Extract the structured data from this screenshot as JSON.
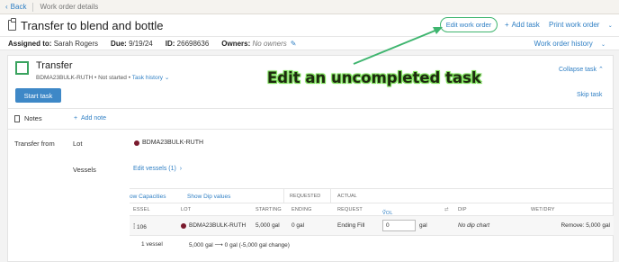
{
  "topbar": {
    "back_label": "Back",
    "breadcrumb": "Work order details"
  },
  "header": {
    "title": "Transfer to blend and bottle",
    "edit_work_order": "Edit work order",
    "add_task": "Add task",
    "print_work_order": "Print work order"
  },
  "meta": {
    "assigned_label": "Assigned to:",
    "assigned_value": "Sarah Rogers",
    "due_label": "Due:",
    "due_value": "9/19/24",
    "id_label": "ID:",
    "id_value": "26698636",
    "owners_label": "Owners:",
    "owners_value": "No owners",
    "history": "Work order history"
  },
  "task": {
    "title": "Transfer",
    "lot_code": "BDMA23BULK-RUTH",
    "status": "Not started",
    "history_link": "Task history",
    "collapse": "Collapse task",
    "start": "Start task",
    "skip": "Skip task"
  },
  "notes": {
    "label": "Notes",
    "add": "Add note"
  },
  "transfer": {
    "from_label": "Transfer from",
    "lot_label": "Lot",
    "lot_value": "BDMA23BULK-RUTH",
    "vessels_label": "Vessels",
    "edit_vessels": "Edit vessels (1)"
  },
  "vessel_table": {
    "show_capacities": "ow Capacities",
    "show_dip": "Show Dip values",
    "requested": "REQUESTED",
    "actual": "ACTUAL",
    "headers": [
      "ESSEL",
      "LOT",
      "STARTING",
      "ENDING",
      "REQUEST",
      "VOL",
      "DIP",
      "WET/DRY"
    ],
    "row": {
      "vessel": "106",
      "lot": "BDMA23BULK-RUTH",
      "starting": "5,000 gal",
      "ending": "0 gal",
      "request": "Ending Fill",
      "vol": "0",
      "vol_unit": "gal",
      "dip": "No dip chart",
      "remove": "Remove: 5,000 gal"
    },
    "footer": {
      "count": "1 vessel",
      "summary": "5,000 gal ⟶ 0 gal (-5,000 gal change)"
    }
  },
  "annotation": {
    "text": "Edit an uncompleted  task"
  },
  "colors": {
    "link": "#2f7fc4",
    "accent_green": "#3fb56f",
    "button_blue": "#3e88c7",
    "lot_dot": "#7a1a2e"
  }
}
